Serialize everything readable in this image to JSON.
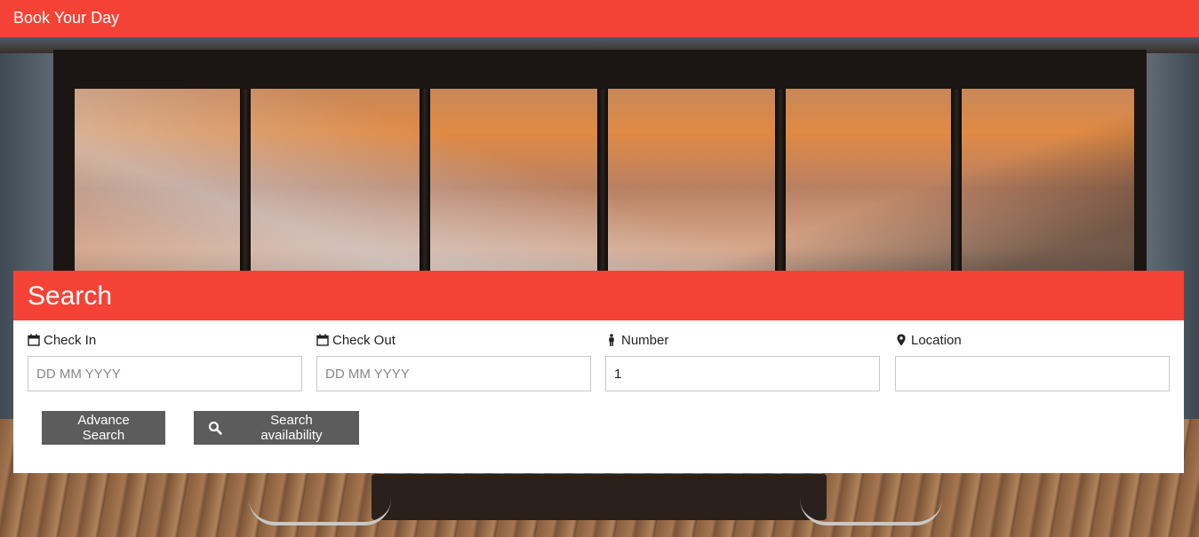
{
  "header": {
    "title": "Book Your Day"
  },
  "search_panel": {
    "title": "Search",
    "fields": {
      "check_in": {
        "label": "Check In",
        "placeholder": "DD MM YYYY",
        "value": ""
      },
      "check_out": {
        "label": "Check Out",
        "placeholder": "DD MM YYYY",
        "value": ""
      },
      "number": {
        "label": "Number",
        "placeholder": "",
        "value": "1"
      },
      "location": {
        "label": "Location",
        "placeholder": "",
        "value": ""
      }
    },
    "buttons": {
      "advance_search": "Advance Search",
      "search_availability": "Search availability"
    }
  },
  "icons": {
    "check_in": "calendar-icon",
    "check_out": "calendar-icon",
    "number": "person-icon",
    "location": "map-marker-icon",
    "search": "search-icon"
  },
  "colors": {
    "accent": "#f44336",
    "button": "#5c5c5c"
  }
}
